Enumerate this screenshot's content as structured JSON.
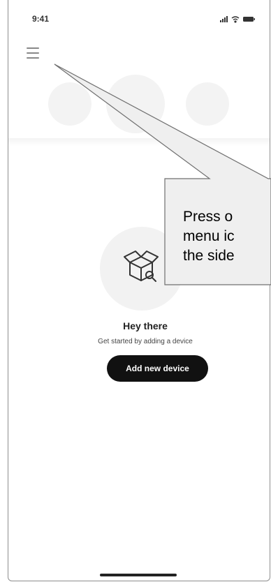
{
  "status_bar": {
    "time": "9:41"
  },
  "empty_state": {
    "title": "Hey there",
    "subtitle": "Get started by adding a device",
    "button_label": "Add new device"
  },
  "callout": {
    "lines": [
      "Press o",
      "menu ic",
      "the side"
    ]
  }
}
